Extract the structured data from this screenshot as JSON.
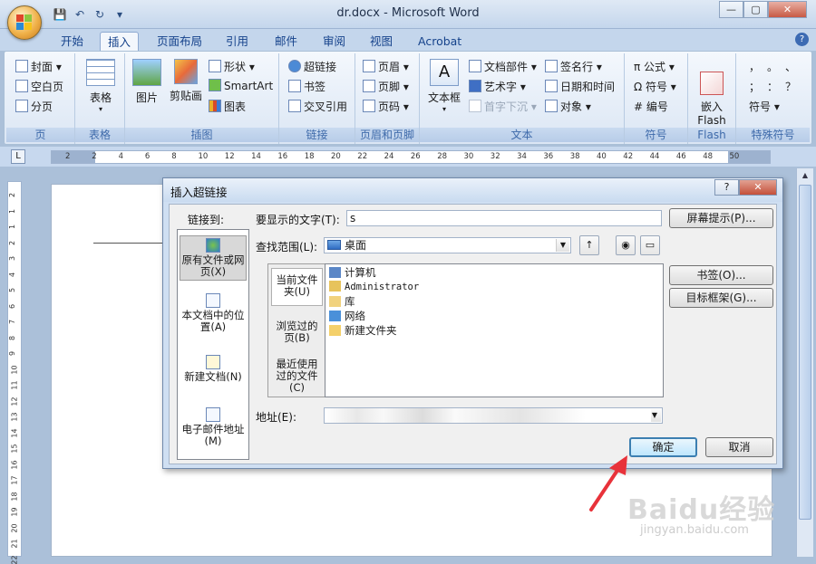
{
  "window": {
    "title": "dr.docx - Microsoft Word",
    "minimize": "—",
    "maximize": "▢",
    "close": "✕"
  },
  "qat": {
    "save": "💾",
    "undo": "↶",
    "redo": "↻",
    "more": "▾"
  },
  "tabs": [
    "开始",
    "插入",
    "页面布局",
    "引用",
    "邮件",
    "审阅",
    "视图",
    "Acrobat"
  ],
  "active_tab": "插入",
  "ribbon": {
    "pages": {
      "label": "页",
      "items": [
        "封面 ▾",
        "空白页",
        "分页"
      ]
    },
    "table": {
      "label": "表格",
      "button": "表格"
    },
    "illustrations": {
      "label": "插图",
      "picture": "图片",
      "clipart": "剪贴画",
      "shapes": "形状 ▾",
      "smartart": "SmartArt",
      "chart": "图表"
    },
    "links": {
      "label": "链接",
      "items": [
        "超链接",
        "书签",
        "交叉引用"
      ]
    },
    "header_footer": {
      "label": "页眉和页脚",
      "items": [
        "页眉 ▾",
        "页脚 ▾",
        "页码 ▾"
      ]
    },
    "text": {
      "label": "文本",
      "textbox": "文本框",
      "items": [
        "文档部件 ▾",
        "艺术字 ▾",
        "首字下沉 ▾",
        "签名行 ▾",
        "日期和时间",
        "对象 ▾"
      ]
    },
    "symbols": {
      "label": "符号",
      "items": [
        "π 公式 ▾",
        "Ω 符号 ▾",
        "# 编号"
      ]
    },
    "flash": {
      "label": "Flash",
      "button": "嵌入\nFlash"
    },
    "special": {
      "label": "特殊符号",
      "chars": [
        "，",
        "。",
        "、",
        "；",
        "：",
        "？"
      ],
      "more": "符号 ▾"
    }
  },
  "ruler": {
    "numbers": [
      "2",
      "2",
      "4",
      "6",
      "8",
      "10",
      "12",
      "14",
      "16",
      "18",
      "20",
      "22",
      "24",
      "26",
      "28",
      "30",
      "32",
      "34",
      "36",
      "38",
      "40",
      "42",
      "44",
      "46",
      "48",
      "50"
    ],
    "vnumbers": [
      "2",
      "1",
      "1",
      "2",
      "3",
      "4",
      "5",
      "6",
      "7",
      "8",
      "9",
      "10",
      "11",
      "12",
      "13",
      "14",
      "15",
      "16",
      "17",
      "18",
      "19",
      "20",
      "21",
      "22"
    ]
  },
  "dialog": {
    "title": "插入超链接",
    "help": "?",
    "close": "✕",
    "link_to_label": "链接到:",
    "link_to": [
      "原有文件或网页(X)",
      "本文档中的位置(A)",
      "新建文档(N)",
      "电子邮件地址(M)"
    ],
    "display_text_label": "要显示的文字(T):",
    "display_text_value": "s",
    "screentip_button": "屏幕提示(P)...",
    "look_in_label": "查找范围(L):",
    "look_in_value": "桌面",
    "nav": [
      "当前文件夹(U)",
      "浏览过的页(B)",
      "最近使用过的文件(C)"
    ],
    "files": [
      "计算机",
      "Administrator",
      "库",
      "网络",
      "新建文件夹"
    ],
    "bookmark_button": "书签(O)...",
    "target_frame_button": "目标框架(G)...",
    "address_label": "地址(E):",
    "ok": "确定",
    "cancel": "取消"
  },
  "watermark": {
    "brand": "Baidu经验",
    "url": "jingyan.baidu.com"
  },
  "colors": {
    "accent": "#15428b",
    "arrow": "#e8323a"
  }
}
